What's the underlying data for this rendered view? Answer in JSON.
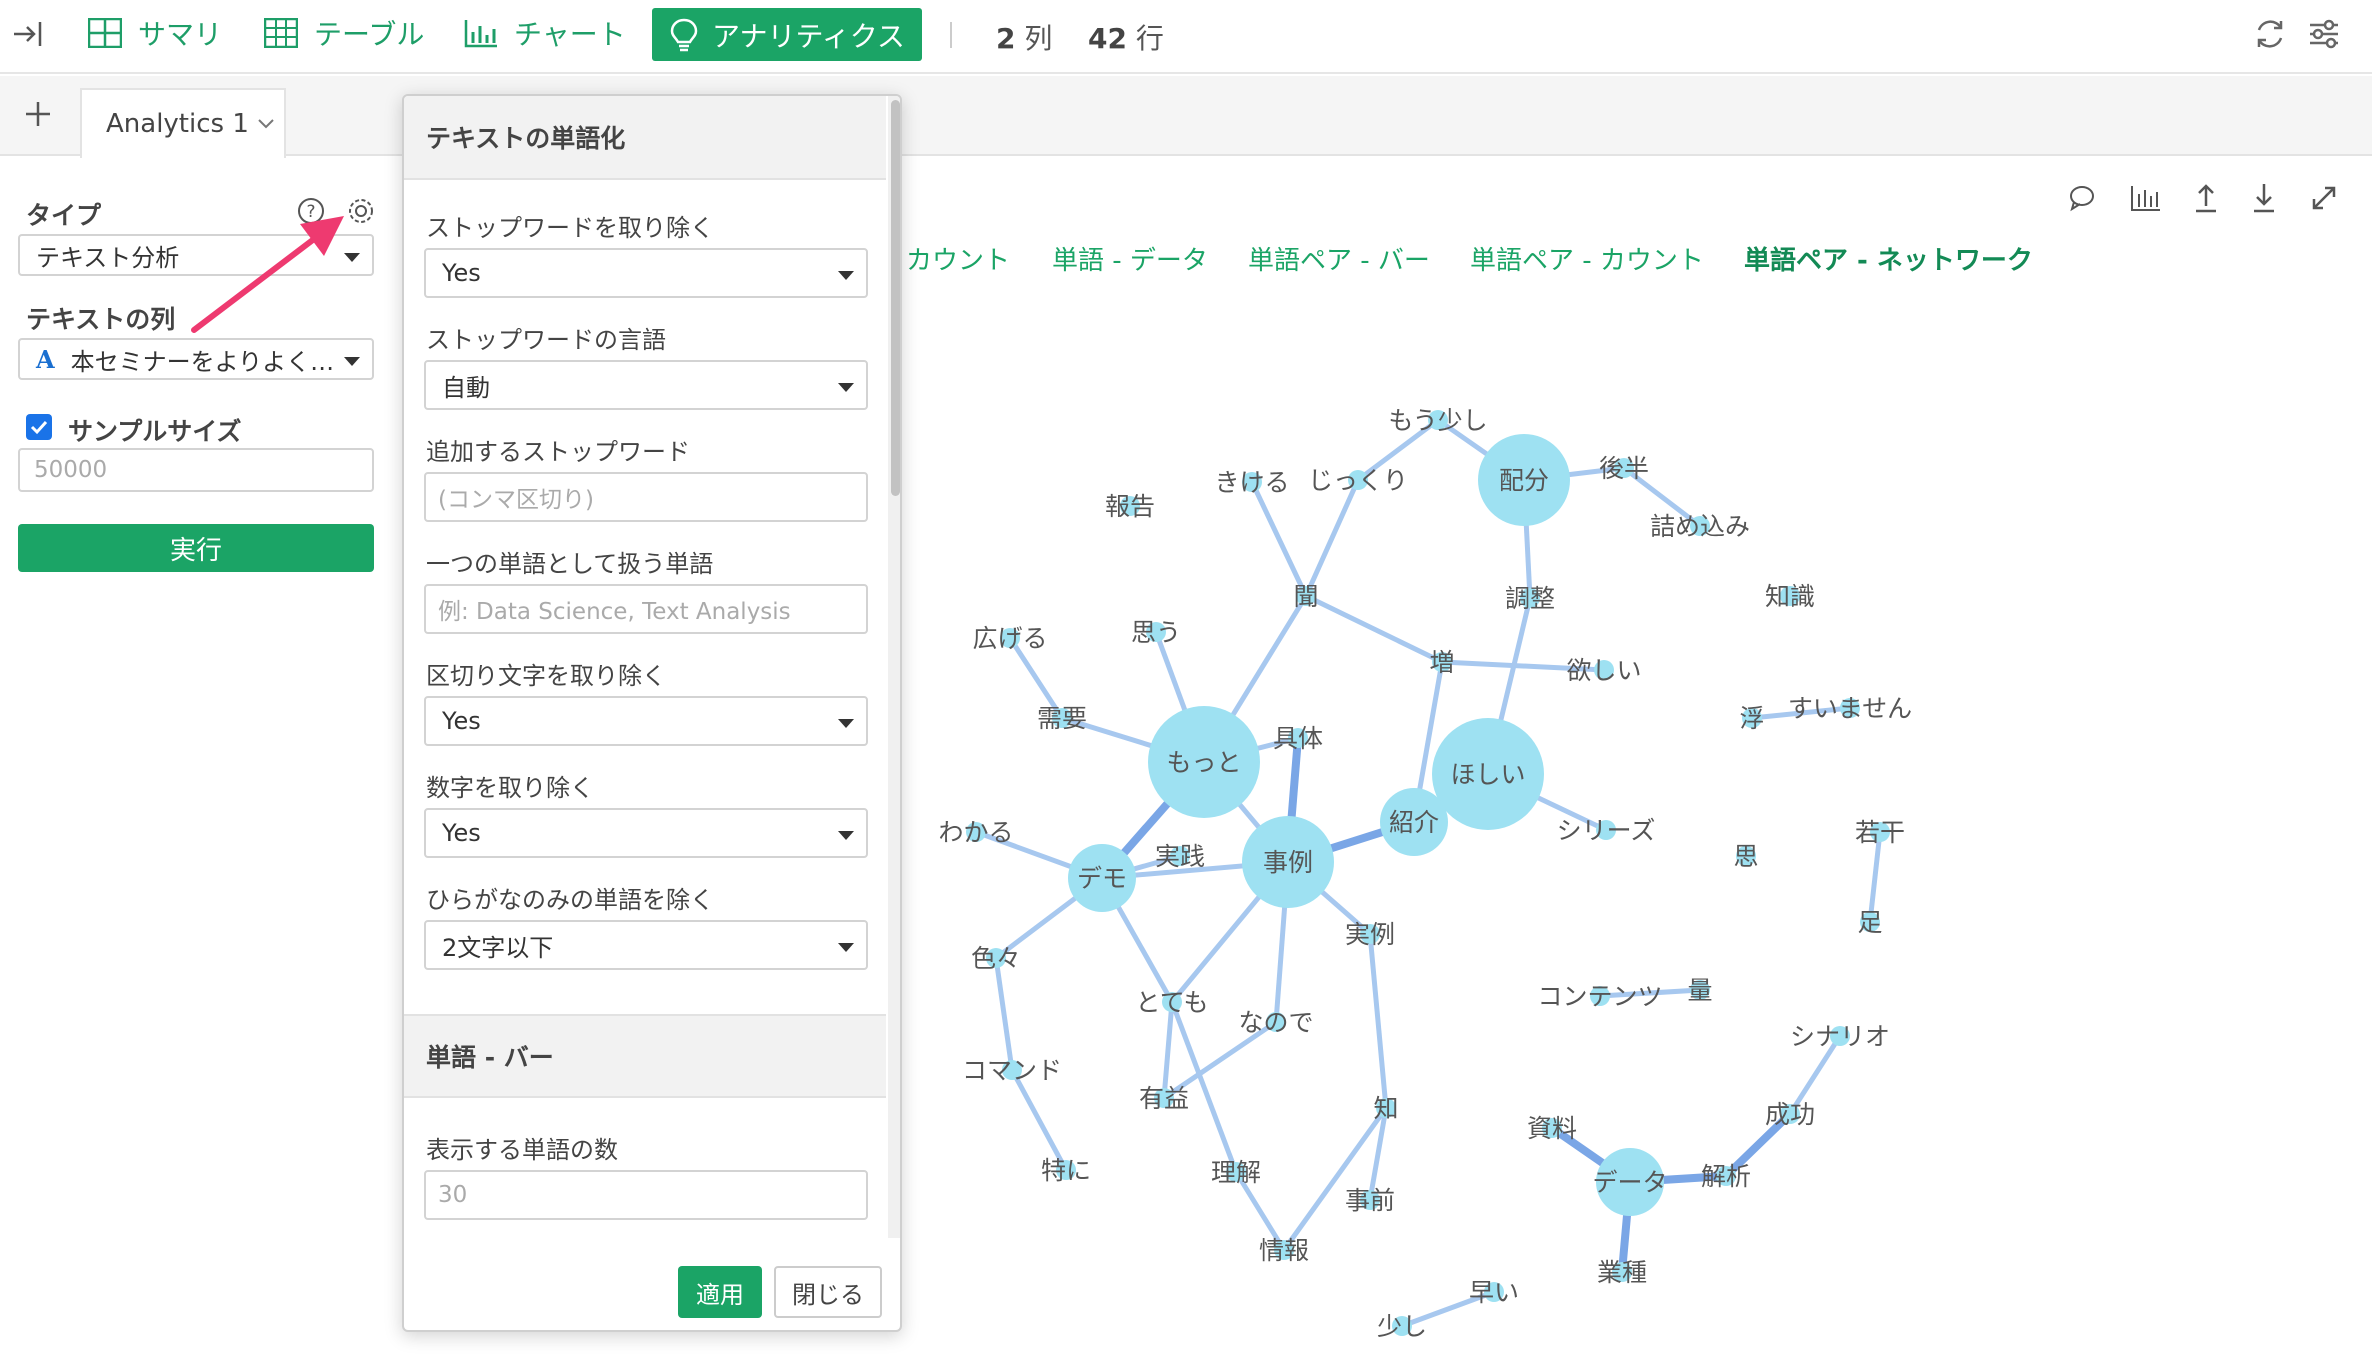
{
  "toolbar": {
    "items": [
      {
        "label": "サマリ",
        "icon": "summary-grid-icon"
      },
      {
        "label": "テーブル",
        "icon": "table-icon"
      },
      {
        "label": "チャート",
        "icon": "bar-chart-icon"
      },
      {
        "label": "アナリティクス",
        "icon": "lightbulb-icon"
      }
    ],
    "cols_count": "2",
    "cols_unit": "列",
    "rows_count": "42",
    "rows_unit": "行"
  },
  "tabs": [
    {
      "label": "Analytics 1"
    }
  ],
  "sidebar": {
    "type_label": "タイプ",
    "type_value": "テキスト分析",
    "text_col_label": "テキストの列",
    "text_col_value": "本セミナーをよりよく…",
    "sample_label": "サンプルサイズ",
    "sample_placeholder": "50000",
    "run_label": "実行"
  },
  "panel": {
    "section1_title": "テキストの単語化",
    "stopwords_label": "ストップワードを取り除く",
    "stopwords_value": "Yes",
    "stopwords_lang_label": "ストップワードの言語",
    "stopwords_lang_value": "自動",
    "extra_stopwords_label": "追加するストップワード",
    "extra_stopwords_placeholder": "(コンマ区切り)",
    "compound_label": "一つの単語として扱う単語",
    "compound_placeholder": "例: Data Science, Text Analysis",
    "punct_label": "区切り文字を取り除く",
    "punct_value": "Yes",
    "numbers_label": "数字を取り除く",
    "numbers_value": "Yes",
    "hiragana_label": "ひらがなのみの単語を除く",
    "hiragana_value": "2文字以下",
    "section2_title": "単語 - バー",
    "word_count_label": "表示する単語の数",
    "word_count_placeholder": "30",
    "apply_label": "適用",
    "close_label": "閉じる"
  },
  "subtabs": [
    "カウント",
    "単語 - データ",
    "単語ペア - バー",
    "単語ペア - カウント",
    "単語ペア - ネットワーク"
  ],
  "colors": {
    "accent": "#1ba466",
    "node": "#9ee1f2",
    "edge": "#a7c8ef",
    "edge_strong": "#7aa6e6",
    "arrow": "#ee3a70"
  },
  "network": {
    "nodes": [
      {
        "id": "もっと",
        "size": 3
      },
      {
        "id": "ほしい",
        "size": 3
      },
      {
        "id": "配分",
        "size": 2
      },
      {
        "id": "事例",
        "size": 2
      },
      {
        "id": "デモ",
        "size": 1
      },
      {
        "id": "紹介",
        "size": 1
      },
      {
        "id": "データ",
        "size": 1
      },
      {
        "id": "知",
        "size": 0
      },
      {
        "id": "特に",
        "size": 0
      },
      {
        "id": "もう少し",
        "size": 0
      },
      {
        "id": "後半",
        "size": 0
      },
      {
        "id": "詰め込み",
        "size": 0
      },
      {
        "id": "きける",
        "size": 0
      },
      {
        "id": "じっくり",
        "size": 0
      },
      {
        "id": "報告",
        "size": 0
      },
      {
        "id": "聞",
        "size": 0
      },
      {
        "id": "調整",
        "size": 0
      },
      {
        "id": "知識",
        "size": 0
      },
      {
        "id": "広げる",
        "size": 0
      },
      {
        "id": "思う",
        "size": 0
      },
      {
        "id": "増",
        "size": 0
      },
      {
        "id": "欲しい",
        "size": 0
      },
      {
        "id": "浮",
        "size": 0
      },
      {
        "id": "すいません",
        "size": 0
      },
      {
        "id": "需要",
        "size": 0
      },
      {
        "id": "具体",
        "size": 0
      },
      {
        "id": "わかる",
        "size": 0
      },
      {
        "id": "実践",
        "size": 0
      },
      {
        "id": "シリーズ",
        "size": 0
      },
      {
        "id": "若干",
        "size": 0
      },
      {
        "id": "思",
        "size": 0
      },
      {
        "id": "足",
        "size": 0
      },
      {
        "id": "色々",
        "size": 0
      },
      {
        "id": "実例",
        "size": 0
      },
      {
        "id": "とても",
        "size": 0
      },
      {
        "id": "なので",
        "size": 0
      },
      {
        "id": "コンテンツ",
        "size": 0
      },
      {
        "id": "量",
        "size": 0
      },
      {
        "id": "シナリオ",
        "size": 0
      },
      {
        "id": "コマンド",
        "size": 0
      },
      {
        "id": "有益",
        "size": 0
      },
      {
        "id": "成功",
        "size": 0
      },
      {
        "id": "資料",
        "size": 0
      },
      {
        "id": "解析",
        "size": 0
      },
      {
        "id": "理解",
        "size": 0
      },
      {
        "id": "事前",
        "size": 0
      },
      {
        "id": "情報",
        "size": 0
      },
      {
        "id": "業種",
        "size": 0
      },
      {
        "id": "早い",
        "size": 0
      },
      {
        "id": "少し",
        "size": 0
      }
    ],
    "edges": [
      [
        "もっと",
        "聞",
        1
      ],
      [
        "もっと",
        "思う",
        1
      ],
      [
        "もっと",
        "需要",
        1
      ],
      [
        "もっと",
        "デモ",
        2
      ],
      [
        "もっと",
        "事例",
        1
      ],
      [
        "もっと",
        "具体",
        1
      ],
      [
        "需要",
        "広げる",
        1
      ],
      [
        "聞",
        "きける",
        1
      ],
      [
        "聞",
        "じっくり",
        1
      ],
      [
        "聞",
        "増",
        1
      ],
      [
        "じっくり",
        "もう少し",
        1
      ],
      [
        "もう少し",
        "配分",
        1
      ],
      [
        "配分",
        "後半",
        1
      ],
      [
        "後半",
        "詰め込み",
        1
      ],
      [
        "配分",
        "調整",
        1
      ],
      [
        "調整",
        "ほしい",
        1
      ],
      [
        "増",
        "欲しい",
        1
      ],
      [
        "増",
        "紹介",
        1
      ],
      [
        "ほしい",
        "紹介",
        1
      ],
      [
        "ほしい",
        "シリーズ",
        1
      ],
      [
        "紹介",
        "事例",
        2
      ],
      [
        "事例",
        "具体",
        2
      ],
      [
        "事例",
        "デモ",
        1
      ],
      [
        "事例",
        "とても",
        1
      ],
      [
        "事例",
        "なので",
        1
      ],
      [
        "事例",
        "実例",
        1
      ],
      [
        "実例",
        "知",
        1
      ],
      [
        "デモ",
        "実践",
        1
      ],
      [
        "デモ",
        "わかる",
        1
      ],
      [
        "デモ",
        "色々",
        1
      ],
      [
        "デモ",
        "とても",
        1
      ],
      [
        "色々",
        "コマンド",
        1
      ],
      [
        "コマンド",
        "特に",
        1
      ],
      [
        "とても",
        "有益",
        1
      ],
      [
        "とても",
        "理解",
        1
      ],
      [
        "有益",
        "なので",
        1
      ],
      [
        "理解",
        "情報",
        1
      ],
      [
        "知",
        "事前",
        1
      ],
      [
        "知",
        "情報",
        1
      ],
      [
        "浮",
        "すいません",
        1
      ],
      [
        "若干",
        "足",
        1
      ],
      [
        "コンテンツ",
        "量",
        1
      ],
      [
        "資料",
        "データ",
        2
      ],
      [
        "データ",
        "解析",
        2
      ],
      [
        "解析",
        "成功",
        2
      ],
      [
        "成功",
        "シナリオ",
        1
      ],
      [
        "データ",
        "業種",
        2
      ],
      [
        "早い",
        "少し",
        1
      ]
    ]
  }
}
